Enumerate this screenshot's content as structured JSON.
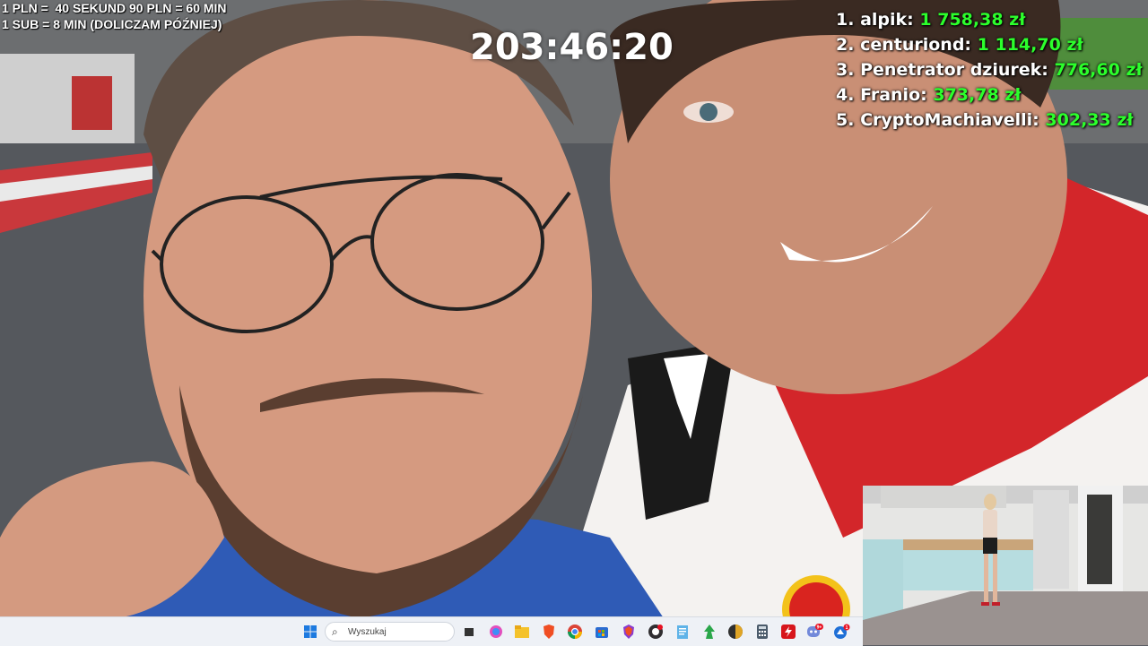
{
  "overlay": {
    "rates_line1": "1 PLN =  40 SEKUND 90 PLN = 60 MIN",
    "rates_line2": "1 SUB = 8 MIN (DOLICZAM PÓŹNIEJ)",
    "timer": "203:46:20"
  },
  "leaderboard": [
    {
      "rank": "1.",
      "name": "alpik:",
      "amount": "1 758,38 zł"
    },
    {
      "rank": "2.",
      "name": "centuriond:",
      "amount": "1 114,70 zł"
    },
    {
      "rank": "3.",
      "name": "Penetrator dziurek:",
      "amount": "776,60 zł"
    },
    {
      "rank": "4.",
      "name": "Franio:",
      "amount": "373,78 zł"
    },
    {
      "rank": "5.",
      "name": "CryptoMachiavelli:",
      "amount": "302,33 zł"
    }
  ],
  "colors": {
    "amount": "#2cff2c",
    "taskbar": "#eef1f6"
  },
  "taskbar": {
    "search_placeholder": "Wyszukaj",
    "icons": [
      "windows-start-icon",
      "search-icon",
      "task-view-icon",
      "copilot-icon",
      "file-explorer-icon",
      "brave-icon",
      "chrome-icon",
      "store-icon",
      "brave-beta-icon",
      "obs-icon",
      "notepad-icon",
      "green-app-icon",
      "globe-app-icon",
      "calculator-icon",
      "streaming-app-icon",
      "discord-icon",
      "app-update-icon"
    ],
    "discord_badge": "9+",
    "update_badge": "1"
  }
}
